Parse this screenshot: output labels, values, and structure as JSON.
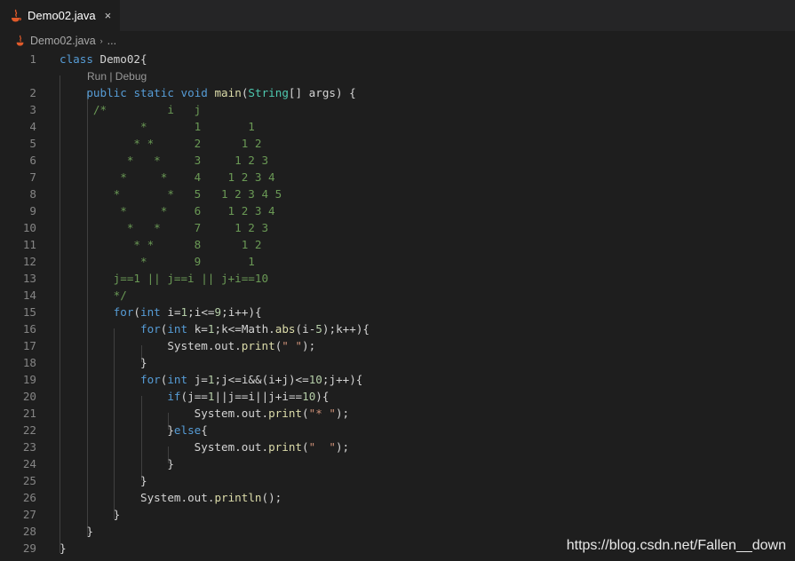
{
  "tab": {
    "label": "Demo02.java",
    "close": "×",
    "icon": "java-icon"
  },
  "breadcrumb": {
    "file": "Demo02.java",
    "separator": "›",
    "more": "..."
  },
  "codelens": "Run | Debug",
  "lines": [
    {
      "n": "1",
      "t": "class Demo02{"
    },
    {
      "n": "2",
      "t": "    public static void main(String[] args) {"
    },
    {
      "n": "3",
      "t": "     /*         i   j"
    },
    {
      "n": "4",
      "t": "            *       1       1"
    },
    {
      "n": "5",
      "t": "           * *      2      1 2"
    },
    {
      "n": "6",
      "t": "          *   *     3     1 2 3"
    },
    {
      "n": "7",
      "t": "         *     *    4    1 2 3 4"
    },
    {
      "n": "8",
      "t": "        *       *   5   1 2 3 4 5"
    },
    {
      "n": "9",
      "t": "         *     *    6    1 2 3 4"
    },
    {
      "n": "10",
      "t": "          *   *     7     1 2 3"
    },
    {
      "n": "11",
      "t": "           * *      8      1 2"
    },
    {
      "n": "12",
      "t": "            *       9       1"
    },
    {
      "n": "13",
      "t": "        j==1 || j==i || j+i==10"
    },
    {
      "n": "14",
      "t": "        */"
    },
    {
      "n": "15",
      "t": "        for(int i=1;i<=9;i++){"
    },
    {
      "n": "16",
      "t": "            for(int k=1;k<=Math.abs(i-5);k++){"
    },
    {
      "n": "17",
      "t": "                System.out.print(\" \");"
    },
    {
      "n": "18",
      "t": "            }"
    },
    {
      "n": "19",
      "t": "            for(int j=1;j<=i&&(i+j)<=10;j++){"
    },
    {
      "n": "20",
      "t": "                if(j==1||j==i||j+i==10){"
    },
    {
      "n": "21",
      "t": "                    System.out.print(\"* \");"
    },
    {
      "n": "22",
      "t": "                }else{"
    },
    {
      "n": "23",
      "t": "                    System.out.print(\"  \");"
    },
    {
      "n": "24",
      "t": "                }"
    },
    {
      "n": "25",
      "t": "            }"
    },
    {
      "n": "26",
      "t": "            System.out.println();"
    },
    {
      "n": "27",
      "t": "        }"
    },
    {
      "n": "28",
      "t": "    }"
    },
    {
      "n": "29",
      "t": "}"
    }
  ],
  "watermark": "https://blog.csdn.net/Fallen__down",
  "colors": {
    "background": "#1e1e1e",
    "keyword": "#569cd6",
    "comment": "#6a9955",
    "function": "#dcdcaa",
    "type": "#4ec9b0",
    "number": "#b5cea8",
    "string": "#ce9178",
    "line_number": "#858585"
  }
}
